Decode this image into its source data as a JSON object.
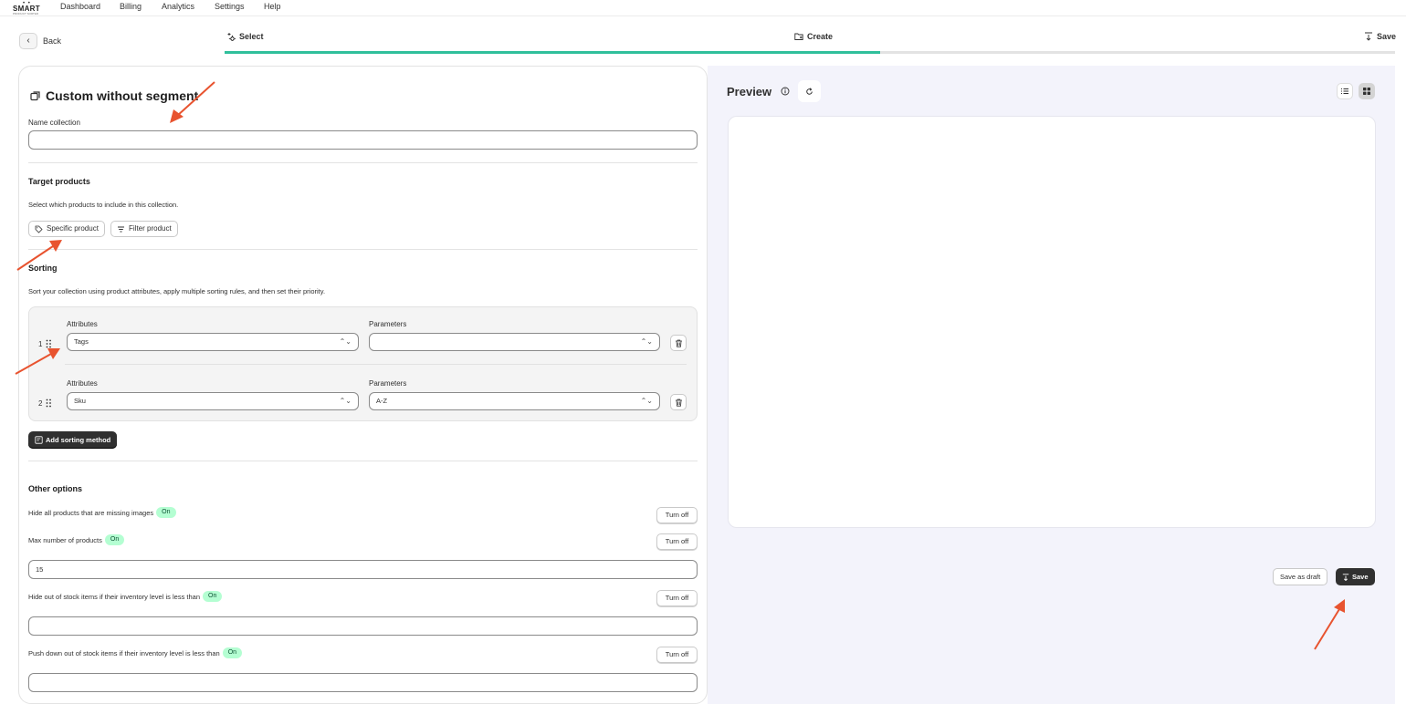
{
  "nav": {
    "logo_word": "SMART",
    "logo_sub": "PRODUCT SORTER",
    "links": [
      "Dashboard",
      "Billing",
      "Analytics",
      "Settings",
      "Help"
    ]
  },
  "back_label": "Back",
  "steps": [
    {
      "label": "Select",
      "icon": "sparkle-icon"
    },
    {
      "label": "Create",
      "icon": "folder-add-icon"
    },
    {
      "label": "Save",
      "icon": "download-icon"
    }
  ],
  "progress": 0.56,
  "form": {
    "title": "Custom without segment",
    "name_label": "Name collection",
    "name_value": "",
    "target": {
      "heading": "Target products",
      "description": "Select which products to include in this collection.",
      "specific_btn": "Specific product",
      "filter_btn": "Filter product"
    },
    "sorting": {
      "heading": "Sorting",
      "description": "Sort your collection using product attributes, apply multiple sorting rules, and then set their priority.",
      "attr_label": "Attributes",
      "param_label": "Parameters",
      "rows": [
        {
          "num": "1",
          "attribute": "Tags",
          "parameter": ""
        },
        {
          "num": "2",
          "attribute": "Sku",
          "parameter": "A-Z"
        }
      ],
      "add_btn": "Add sorting method"
    },
    "options": {
      "heading": "Other options",
      "badge": "On",
      "turn_off": "Turn off",
      "items": [
        {
          "label": "Hide all products that are missing images"
        },
        {
          "label": "Max number of products",
          "value": "15"
        },
        {
          "label": "Hide out of stock items if their inventory level is less than",
          "value": ""
        },
        {
          "label": "Push down out of stock items if their inventory level is less than",
          "value": ""
        }
      ]
    }
  },
  "preview": {
    "title": "Preview",
    "save_draft": "Save as draft",
    "save": "Save"
  },
  "colors": {
    "accent": "#2fbf9b",
    "annotation": "#e8532f",
    "dark_button": "#303030",
    "badge_bg": "#b4fed2"
  }
}
